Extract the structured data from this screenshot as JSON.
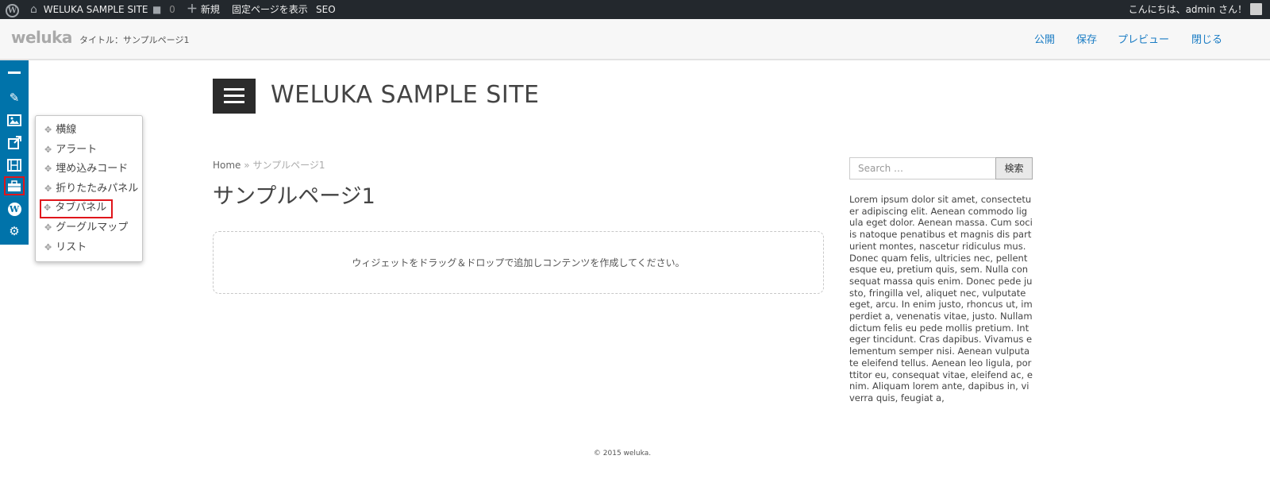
{
  "adminbar": {
    "wp_logo_icon": "wordpress-icon",
    "site_icon": "home-icon",
    "site_name": "WELUKA SAMPLE SITE",
    "comments_icon": "comment-icon",
    "comments_count": "0",
    "new_icon": "plus-icon",
    "new_label": "新規",
    "view_page": "固定ページを表示",
    "seo": "SEO",
    "greeting": "こんにちは、admin さん！"
  },
  "editor": {
    "brand": "weluka",
    "title": "タイトル：サンプルページ1",
    "actions": {
      "publish": "公開",
      "save": "保存",
      "preview": "プレビュー",
      "close": "閉じる"
    },
    "accent_color": "#1a7cc4"
  },
  "tools": [
    {
      "name": "horizontal-rule-icon",
      "glyph": "━"
    },
    {
      "name": "pencil-icon",
      "glyph": "✎"
    },
    {
      "name": "image-icon",
      "glyph": "▣"
    },
    {
      "name": "external-link-icon",
      "glyph": "⇱"
    },
    {
      "name": "film-icon",
      "glyph": "▤"
    },
    {
      "name": "briefcase-icon",
      "glyph": "▬"
    },
    {
      "name": "wordpress-icon",
      "glyph": "W"
    },
    {
      "name": "gear-icon",
      "glyph": "⚙"
    }
  ],
  "popup_menu": {
    "move_icon": "move-icon",
    "items": [
      "横線",
      "アラート",
      "埋め込みコード",
      "折りたたみパネル",
      "タブパネル",
      "グーグルマップ",
      "リスト"
    ],
    "selected": "タブパネル"
  },
  "site": {
    "menu_icon": "hamburger-icon",
    "title": "WELUKA SAMPLE SITE"
  },
  "content": {
    "breadcrumb_home": "Home",
    "breadcrumb_sep": "»",
    "breadcrumb_current": "サンプルページ1",
    "heading": "サンプルページ1",
    "dropzone_text": "ウィジェットをドラッグ＆ドロップで追加しコンテンツを作成してください。"
  },
  "sidebar": {
    "search_placeholder": "Search …",
    "search_button": "検索",
    "text": "Lorem ipsum dolor sit amet, consectetuer adipiscing elit. Aenean commodo ligula eget dolor. Aenean massa. Cum sociis natoque penatibus et magnis dis parturient montes, nascetur ridiculus mus. Donec quam felis, ultricies nec, pellentesque eu, pretium quis, sem. Nulla consequat massa quis enim. Donec pede justo, fringilla vel, aliquet nec, vulputate eget, arcu. In enim justo, rhoncus ut, imperdiet a, venenatis vitae, justo. Nullam dictum felis eu pede mollis pretium. Integer tincidunt. Cras dapibus. Vivamus elementum semper nisi. Aenean vulputate eleifend tellus. Aenean leo ligula, porttitor eu, consequat vitae, eleifend ac, enim. Aliquam lorem ante, dapibus in, viverra quis, feugiat a,"
  },
  "footer": {
    "copyright": "© 2015 weluka."
  }
}
